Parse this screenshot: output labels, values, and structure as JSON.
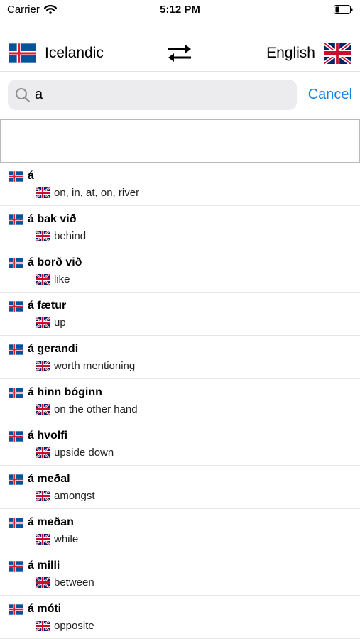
{
  "status_bar": {
    "carrier": "Carrier",
    "time": "5:12 PM"
  },
  "language_bar": {
    "source_language": "Icelandic",
    "target_language": "English"
  },
  "search": {
    "query": "a",
    "cancel_label": "Cancel"
  },
  "results": [
    {
      "term": "á",
      "translation": "on, in, at, on, river"
    },
    {
      "term": "á bak við",
      "translation": "behind"
    },
    {
      "term": "á borð við",
      "translation": "like"
    },
    {
      "term": "á fætur",
      "translation": "up"
    },
    {
      "term": "á gerandi",
      "translation": "worth mentioning"
    },
    {
      "term": "á hinn bóginn",
      "translation": "on the other hand"
    },
    {
      "term": "á hvolfi",
      "translation": "upside down"
    },
    {
      "term": "á meðal",
      "translation": "amongst"
    },
    {
      "term": "á meðan",
      "translation": "while"
    },
    {
      "term": "á milli",
      "translation": "between"
    },
    {
      "term": "á móti",
      "translation": "opposite"
    }
  ],
  "colors": {
    "accent": "#1a82e2",
    "iceland_blue": "#02529C",
    "iceland_red": "#DC1E35",
    "uk_blue": "#012169",
    "uk_red": "#C8102E"
  },
  "icons": [
    "wifi-icon",
    "battery-icon",
    "iceland-flag-icon",
    "swap-icon",
    "uk-flag-icon",
    "search-icon"
  ]
}
